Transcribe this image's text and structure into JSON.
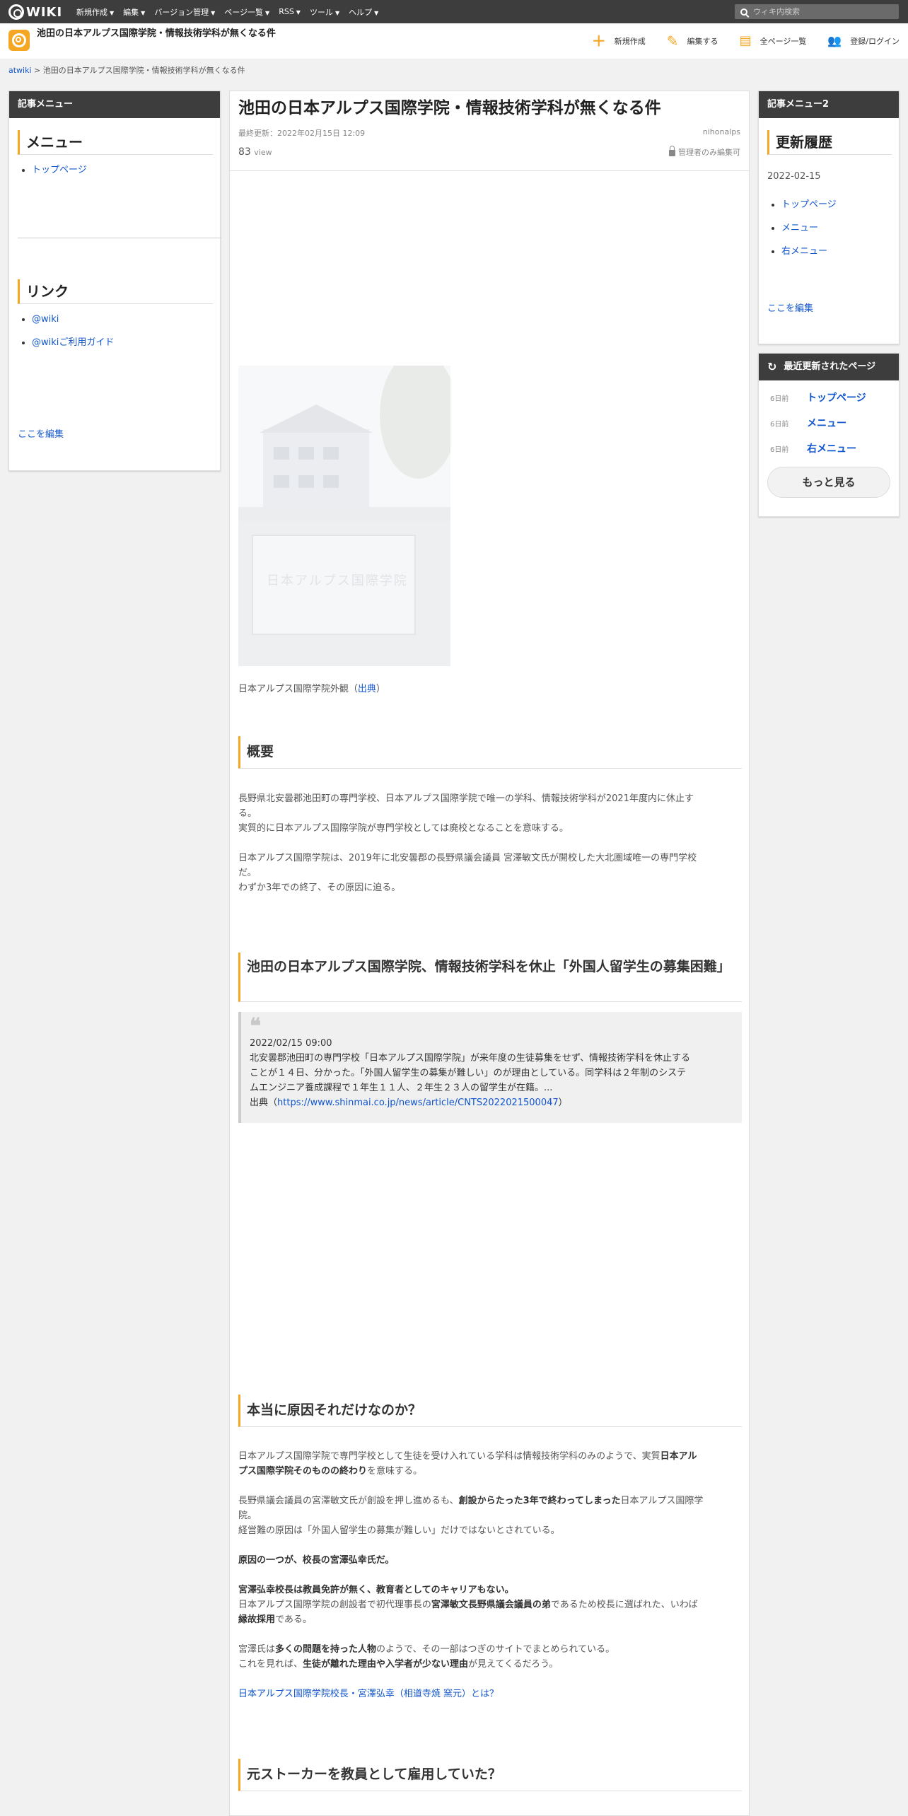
{
  "topbar": {
    "logo": "WIKI",
    "nav": [
      {
        "label": "新規作成"
      },
      {
        "label": "編集"
      },
      {
        "label": "バージョン管理"
      },
      {
        "label": "ページ一覧"
      },
      {
        "label": "RSS"
      },
      {
        "label": "ツール"
      },
      {
        "label": "ヘルプ"
      }
    ],
    "search_placeholder": "ウィキ内検索"
  },
  "header": {
    "site_title": "池田の日本アルプス国際学院・情報技術学科が無くなる件",
    "actions": [
      {
        "label": "新規作成",
        "icon": "plus-icon"
      },
      {
        "label": "編集する",
        "icon": "pencil-icon"
      },
      {
        "label": "全ページ一覧",
        "icon": "document-icon"
      },
      {
        "label": "登録/ログイン",
        "icon": "user-add-icon"
      }
    ]
  },
  "breadcrumb": {
    "root": "atwiki",
    "separator": ">",
    "current": "池田の日本アルプス国際学院・情報技術学科が無くなる件"
  },
  "left_menu": {
    "header": "記事メニュー",
    "menu_title": "メニュー",
    "menu_items": [
      {
        "label": "トップページ"
      }
    ],
    "links_title": "リンク",
    "link_items": [
      {
        "label": "@wiki"
      },
      {
        "label": "@wikiご利用ガイド"
      }
    ],
    "edit_link": "ここを編集"
  },
  "article": {
    "title": "池田の日本アルプス国際学院・情報技術学科が無くなる件",
    "last_updated": "最終更新：2022年02月15日 12:09",
    "author": "nihonalps",
    "views": "83",
    "views_unit": "view",
    "permission": "管理者のみ編集可",
    "image_caption_prefix": "日本アルプス国際学院外観（",
    "image_caption_link": "出典",
    "image_caption_suffix": "）",
    "image_sign_text": "日本アルプス国際学院",
    "sections": {
      "overview_heading": "概要",
      "overview_p1_l1": "長野県北安曇郡池田町の専門学校、日本アルプス国際学院で唯一の学科、情報技術学科が2021年度内に休止す",
      "overview_p1_l2": "る。",
      "overview_p1_l3": "実質的に日本アルプス国際学院が専門学校としては廃校となることを意味する。",
      "overview_p2_l1": "日本アルプス国際学院は、2019年に北安曇郡の長野県議会議員 宮澤敏文氏が開校した大北圏域唯一の専門学校",
      "overview_p2_l2": "だ。",
      "overview_p2_l3": "わずか3年での終了、その原因に迫る。",
      "news_heading": "池田の日本アルプス国際学院、情報技術学科を休止「外国人留学生の募集困難」",
      "quote_date": "2022/02/15 09:00",
      "quote_l1": "北安曇郡池田町の専門学校「日本アルプス国際学院」が来年度の生徒募集をせず、情報技術学科を休止する",
      "quote_l2": "ことが１４日、分かった。「外国人留学生の募集が難しい」のが理由としている。同学科は２年制のシステ",
      "quote_l3": "ムエンジニア養成課程で１年生１１人、２年生２３人の留学生が在籍。...",
      "quote_source_prefix": "出典（",
      "quote_source_link": "https://www.shinmai.co.jp/news/article/CNTS2022021500047",
      "quote_source_suffix": "）",
      "cause_heading": "本当に原因それだけなのか？",
      "cause_p1_a": "日本アルプス国際学院で専門学校として生徒を受け入れている学科は情報技術学科のみのようで、実質",
      "cause_p1_b": "日本アル",
      "cause_p1_c": "プス国際学院そのものの終わり",
      "cause_p1_d": "を意味する。",
      "cause_p2_a": "長野県議会議員の宮澤敏文氏が創設を押し進めるも、",
      "cause_p2_b": "創設からたった3年で終わってしまった",
      "cause_p2_c": "日本アルプス国際学",
      "cause_p2_d": "院。",
      "cause_p2_e": "経営難の原因は「外国人留学生の募集が難しい」だけではないとされている。",
      "cause_p3": "原因の一つが、校長の宮澤弘幸氏だ。",
      "cause_p4_a": "宮澤弘幸校長は教員免許が無く、教育者としてのキャリアもない。",
      "cause_p4_b": "日本アルプス国際学院の創設者で初代理事長の",
      "cause_p4_c": "宮澤敏文長野県議会議員の弟",
      "cause_p4_d": "であるため校長に選ばれた、いわば",
      "cause_p4_e": "縁故採用",
      "cause_p4_f": "である。",
      "cause_p5_a": "宮澤氏は",
      "cause_p5_b": "多くの問題を持った人物",
      "cause_p5_c": "のようで、その一部はつぎのサイトでまとめられている。",
      "cause_p5_d": "これを見れば、",
      "cause_p5_e": "生徒が離れた理由や入学者が少ない理由",
      "cause_p5_f": "が見えてくるだろう。",
      "cause_link": "日本アルプス国際学院校長・宮澤弘幸（相道寺焼 窯元）とは？",
      "stalker_heading": "元ストーカーを教員として雇用していた？"
    }
  },
  "right_menu": {
    "header": "記事メニュー2",
    "history_title": "更新履歴",
    "history_date": "2022-02-15",
    "history_items": [
      {
        "label": "トップページ"
      },
      {
        "label": "メニュー"
      },
      {
        "label": "右メニュー"
      }
    ],
    "edit_link": "ここを編集"
  },
  "recent": {
    "header": "最近更新されたページ",
    "items": [
      {
        "age": "6日前",
        "label": "トップページ"
      },
      {
        "age": "6日前",
        "label": "メニュー"
      },
      {
        "age": "6日前",
        "label": "右メニュー"
      }
    ],
    "more": "もっと見る"
  }
}
